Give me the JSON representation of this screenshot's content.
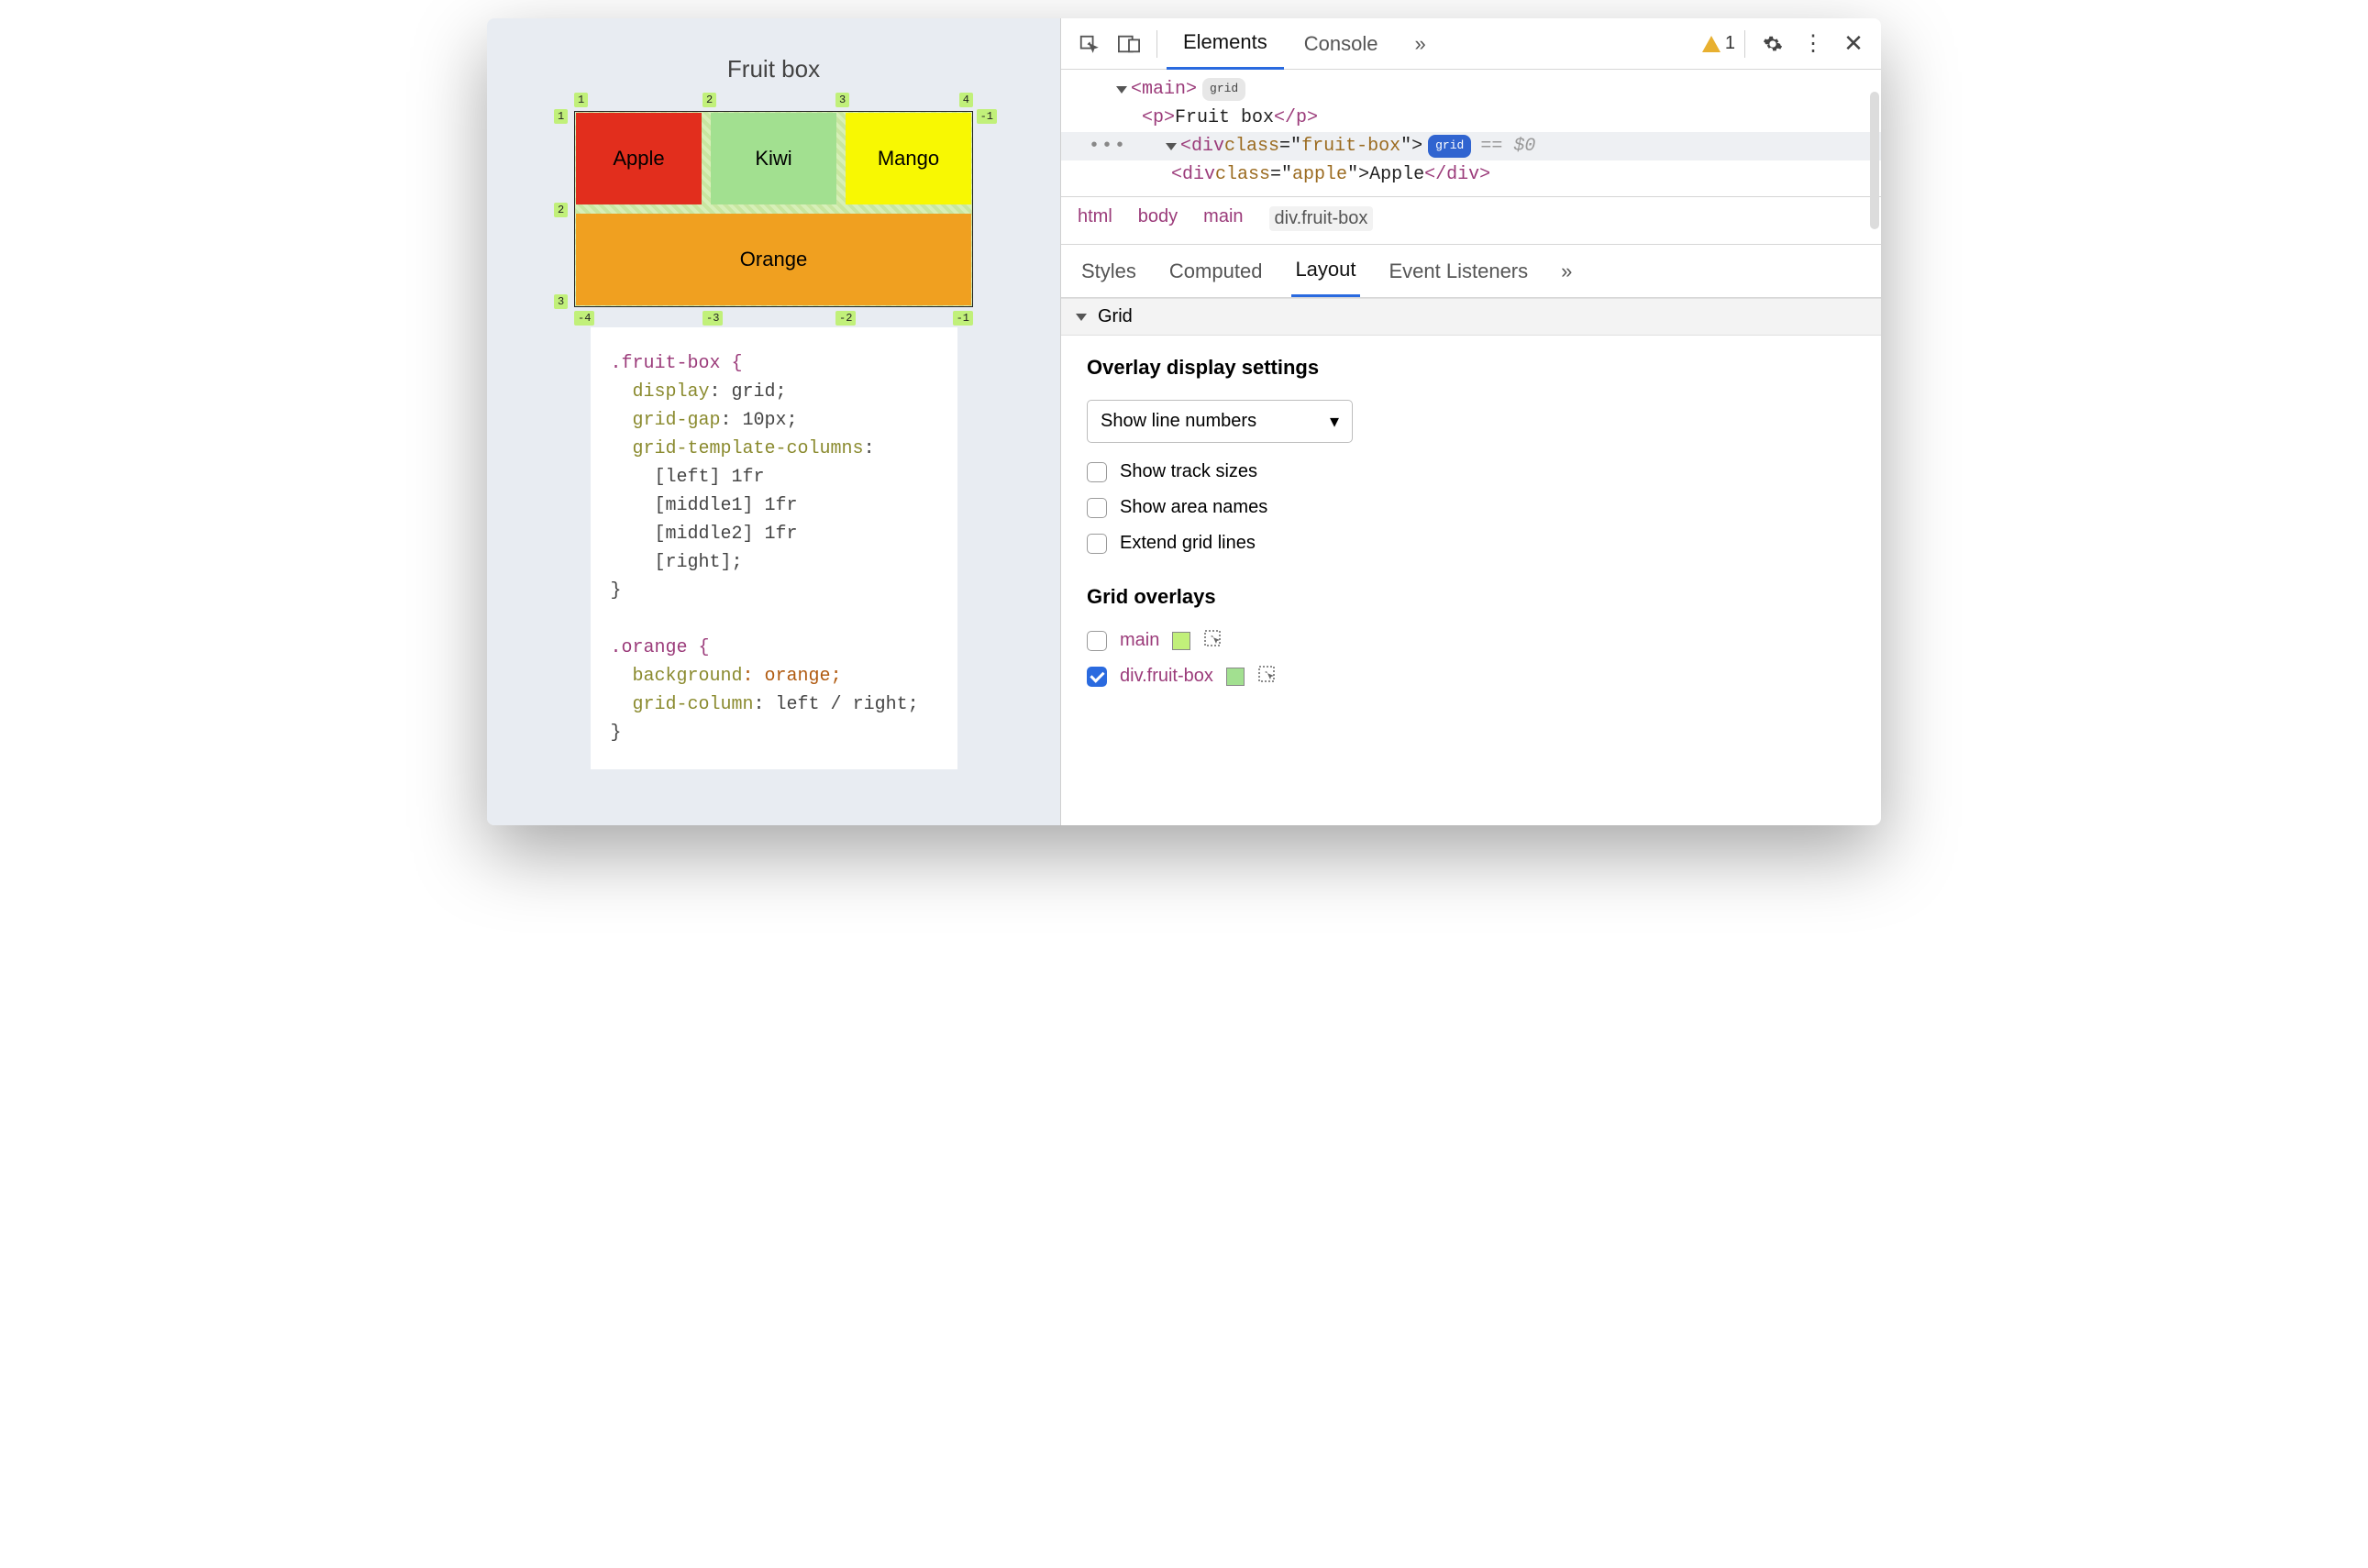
{
  "page": {
    "title": "Fruit box",
    "cells": {
      "apple": "Apple",
      "kiwi": "Kiwi",
      "mango": "Mango",
      "orange": "Orange"
    },
    "grid_numbers": {
      "top": [
        "1",
        "2",
        "3",
        "4"
      ],
      "bottom": [
        "-4",
        "-3",
        "-2",
        "-1"
      ],
      "left": [
        "1",
        "2",
        "3"
      ],
      "right": [
        "-1"
      ]
    }
  },
  "css": {
    "fruit_box_selector": ".fruit-box {",
    "fb": {
      "display_k": "display",
      "display_v": ": grid;",
      "gap_k": "grid-gap",
      "gap_v": ": 10px;",
      "cols_k": "grid-template-columns",
      "cols_v": ":",
      "l1": "[left] 1fr",
      "l2": "[middle1] 1fr",
      "l3": "[middle2] 1fr",
      "l4": "[right];"
    },
    "close": "}",
    "orange_selector": ".orange {",
    "or": {
      "bg_k": "background",
      "bg_v": ": orange;",
      "gc_k": "grid-column",
      "gc_v": ": left / right;"
    }
  },
  "devtools": {
    "tabs": {
      "elements": "Elements",
      "console": "Console",
      "more": "»"
    },
    "warning_count": "1",
    "dom": {
      "main_open": "<main>",
      "main_badge": "grid",
      "p_open": "<p>",
      "p_text": "Fruit box",
      "p_close": "</p>",
      "div_open": "<div ",
      "class_k": "class",
      "class_eq": "=\"",
      "class_v": "fruit-box",
      "class_q": "\">",
      "div_badge": "grid",
      "ghost": " == $0",
      "apple_open": "<div ",
      "apple_class_k": "class",
      "apple_eq": "=\"",
      "apple_class_v": "apple",
      "apple_q": "\">",
      "apple_text": "Apple",
      "apple_close": "</div>"
    },
    "breadcrumbs": [
      "html",
      "body",
      "main",
      "div.fruit-box"
    ],
    "subtabs": {
      "styles": "Styles",
      "computed": "Computed",
      "layout": "Layout",
      "listeners": "Event Listeners",
      "more": "»"
    },
    "grid_section": "Grid",
    "overlay_settings_title": "Overlay display settings",
    "line_numbers_select": "Show line numbers",
    "opts": {
      "track": "Show track sizes",
      "area": "Show area names",
      "extend": "Extend grid lines"
    },
    "overlays_title": "Grid overlays",
    "overlays": [
      {
        "name": "main",
        "checked": false,
        "color": "#c1f07a"
      },
      {
        "name": "div.fruit-box",
        "checked": true,
        "color": "#a2e090"
      }
    ]
  }
}
